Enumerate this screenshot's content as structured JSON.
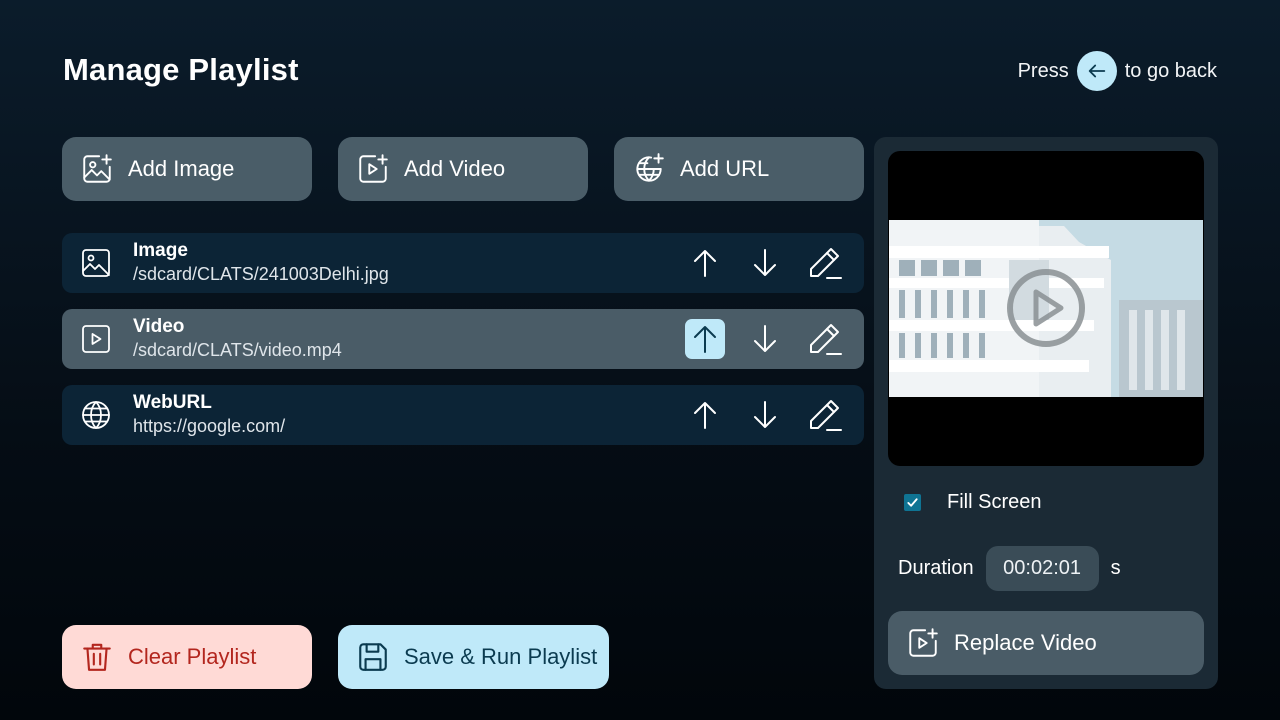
{
  "header": {
    "title": "Manage Playlist",
    "hint_prefix": "Press",
    "hint_suffix": "to go back"
  },
  "add_buttons": {
    "image": "Add Image",
    "video": "Add Video",
    "url": "Add URL"
  },
  "playlist": [
    {
      "type": "Image",
      "path": "/sdcard/CLATS/241003Delhi.jpg",
      "icon": "image-icon"
    },
    {
      "type": "Video",
      "path": "/sdcard/CLATS/video.mp4",
      "icon": "video-icon",
      "selected": true,
      "focused_action": "move-up"
    },
    {
      "type": "WebURL",
      "path": "https://google.com/",
      "icon": "globe-icon"
    }
  ],
  "actions": {
    "clear": "Clear Playlist",
    "save_run": "Save & Run Playlist"
  },
  "panel": {
    "fill_screen_label": "Fill Screen",
    "fill_screen_checked": true,
    "duration_label": "Duration",
    "duration_value": "00:02:01",
    "duration_unit": "s",
    "replace_label": "Replace Video"
  },
  "colors": {
    "accent": "#bfe9f9",
    "button_bg": "#4a5d68",
    "row_bg": "#0c2436",
    "danger_bg": "#ffdad6",
    "danger_fg": "#b3261e",
    "checkbox": "#0f7493"
  }
}
